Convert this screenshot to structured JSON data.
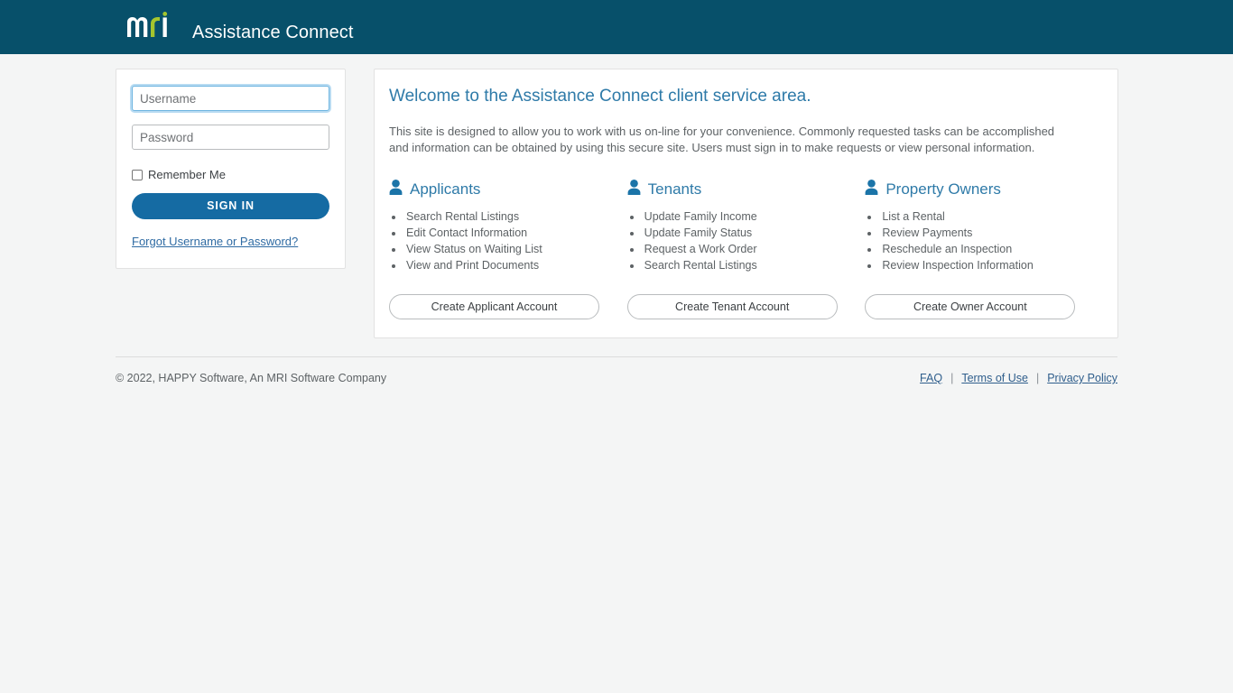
{
  "header": {
    "logo_mark": "mri-logo",
    "logo_letters": {
      "m": "m",
      "r": "r",
      "i": "i"
    },
    "title": "Assistance Connect",
    "bg_color": "#07506a",
    "logo_green": "#a4c52e",
    "logo_white": "#ffffff"
  },
  "login": {
    "username": {
      "value": "",
      "placeholder": "Username",
      "focused": true
    },
    "password": {
      "value": "",
      "placeholder": "Password",
      "focused": false
    },
    "remember_label": "Remember Me",
    "remember_checked": false,
    "signin_label": "SIGN IN",
    "signin_color": "#156ba3",
    "forgot_label": "Forgot Username or Password?",
    "link_color": "#2f6ba3"
  },
  "main": {
    "title": "Welcome to the Assistance Connect client service area.",
    "title_color": "#2e7aa8",
    "intro": "This site is designed to allow you to work with us on-line for your convenience. Commonly requested tasks can be accomplished and information can be obtained by using this secure site. Users must sign in to make requests or view personal information.",
    "columns": [
      {
        "icon": "person-icon",
        "title": "Applicants",
        "items": [
          "Search Rental Listings",
          "Edit Contact Information",
          "View Status on Waiting List",
          "View and Print Documents"
        ],
        "button_label": "Create Applicant Account"
      },
      {
        "icon": "person-icon",
        "title": "Tenants",
        "items": [
          "Update Family Income",
          "Update Family Status",
          "Request a Work Order",
          "Search Rental Listings"
        ],
        "button_label": "Create Tenant Account"
      },
      {
        "icon": "person-icon",
        "title": "Property Owners",
        "items": [
          "List a Rental",
          "Review Payments",
          "Reschedule an Inspection",
          "Review Inspection Information"
        ],
        "button_label": "Create Owner Account"
      }
    ]
  },
  "footer": {
    "copyright": "© 2022, HAPPY Software, An MRI Software Company",
    "links": [
      {
        "label": "FAQ"
      },
      {
        "label": "Terms of Use"
      },
      {
        "label": "Privacy Policy"
      }
    ],
    "separator": "|",
    "link_color": "#2f5e8c"
  }
}
